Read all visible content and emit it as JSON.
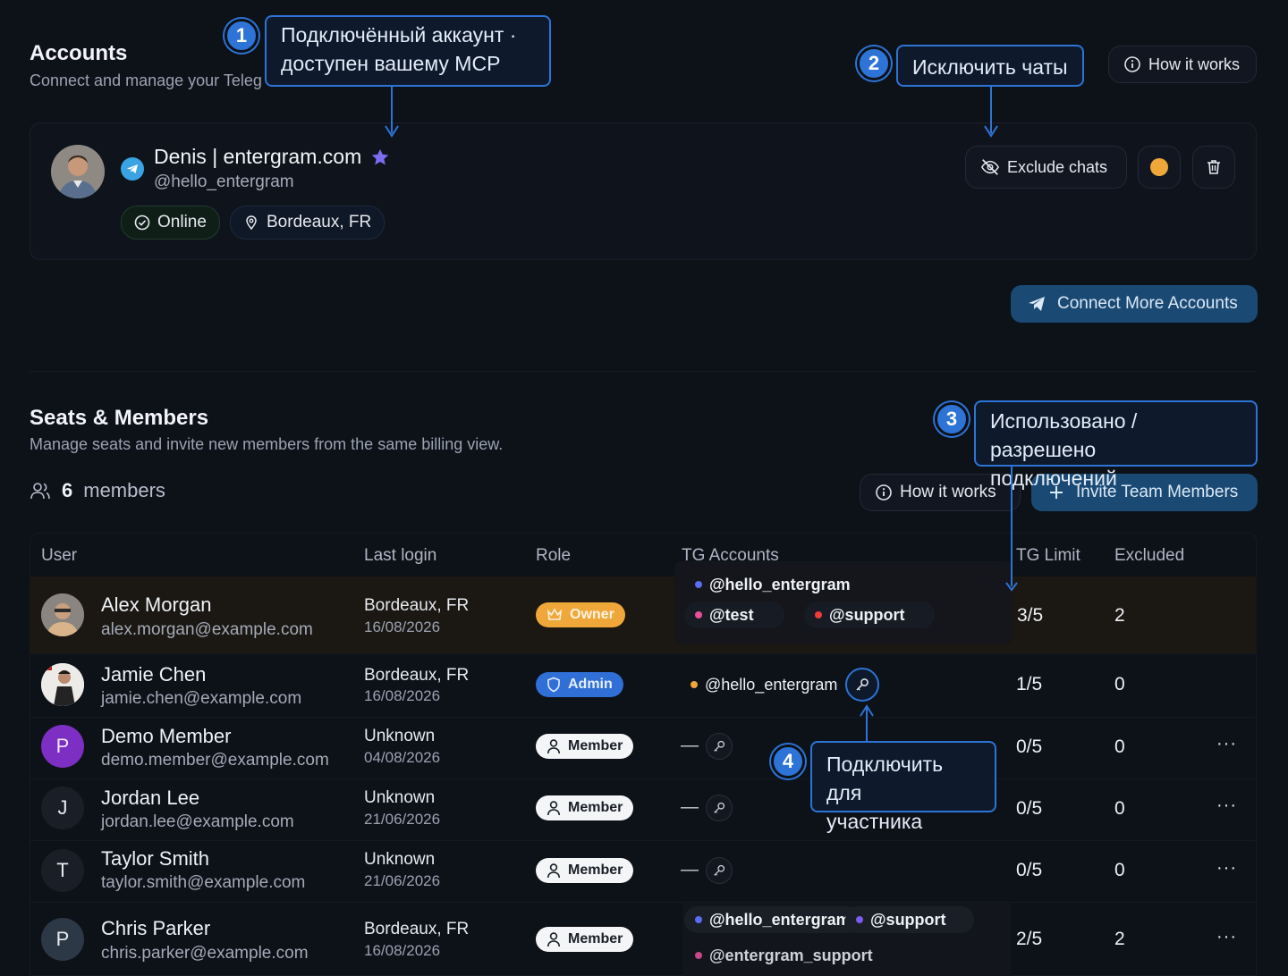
{
  "accounts": {
    "title": "Accounts",
    "subtitle": "Connect and manage your Teleg",
    "how_it_works": "How it works",
    "account": {
      "name": "Denis | entergram.com",
      "username": "@hello_entergram",
      "status": "Online",
      "location": "Bordeaux, FR",
      "exclude_chats": "Exclude chats",
      "status_color": "#f0a73a"
    },
    "connect_more": "Connect More Accounts"
  },
  "callouts": {
    "c1_num": "1",
    "c1_line1": "Подключённый аккаунт ·",
    "c1_line2": "доступен вашему MCP",
    "c2_num": "2",
    "c2_text": "Исключить чаты",
    "c3_num": "3",
    "c3_line1": "Использовано / разрешено",
    "c3_line2": "подключений",
    "c4_num": "4",
    "c4_line1": "Подключить для",
    "c4_line2": "участника"
  },
  "seats": {
    "title": "Seats & Members",
    "subtitle": "Manage seats and invite new members from the same billing view.",
    "count": "6",
    "count_label": "members",
    "how_it_works": "How it works",
    "invite": "Invite Team Members",
    "columns": [
      "User",
      "Last login",
      "Role",
      "TG Accounts",
      "TG Limit",
      "Excluded"
    ],
    "rows": [
      {
        "name": "Alex Morgan",
        "email": "alex.morgan@example.com",
        "location": "Bordeaux, FR",
        "date": "16/08/2026",
        "role": "Owner",
        "accounts": [
          "@hello_entergram",
          "@test",
          "@support"
        ],
        "limit": "3/5",
        "excluded": "2",
        "avatar": ""
      },
      {
        "name": "Jamie Chen",
        "email": "jamie.chen@example.com",
        "location": "Bordeaux, FR",
        "date": "16/08/2026",
        "role": "Admin",
        "accounts": [
          "@hello_entergram"
        ],
        "limit": "1/5",
        "excluded": "0",
        "avatar": ""
      },
      {
        "name": "Demo Member",
        "email": "demo.member@example.com",
        "location": "Unknown",
        "date": "04/08/2026",
        "role": "Member",
        "accounts": [
          "—"
        ],
        "limit": "0/5",
        "excluded": "0",
        "avatar": "P"
      },
      {
        "name": "Jordan Lee",
        "email": "jordan.lee@example.com",
        "location": "Unknown",
        "date": "21/06/2026",
        "role": "Member",
        "accounts": [
          "—"
        ],
        "limit": "0/5",
        "excluded": "0",
        "avatar": "J"
      },
      {
        "name": "Taylor Smith",
        "email": "taylor.smith@example.com",
        "location": "Unknown",
        "date": "21/06/2026",
        "role": "Member",
        "accounts": [
          "—"
        ],
        "limit": "0/5",
        "excluded": "0",
        "avatar": "T"
      },
      {
        "name": "Chris Parker",
        "email": "chris.parker@example.com",
        "location": "Bordeaux, FR",
        "date": "16/08/2026",
        "role": "Member",
        "accounts": [
          "@hello_entergram",
          "@support",
          "@entergram_support"
        ],
        "limit": "2/5",
        "excluded": "2",
        "avatar": "P"
      }
    ],
    "more": "···"
  },
  "colors": {
    "accent": "#2d74d6",
    "owner": "#f0a73a",
    "admin": "#2f6fd6",
    "dot_blue": "#5b6cf0",
    "dot_pink": "#e94f9a",
    "dot_red": "#ef3b3b",
    "dot_orange": "#f0a73a",
    "dot_purple": "#7c5cf0"
  }
}
